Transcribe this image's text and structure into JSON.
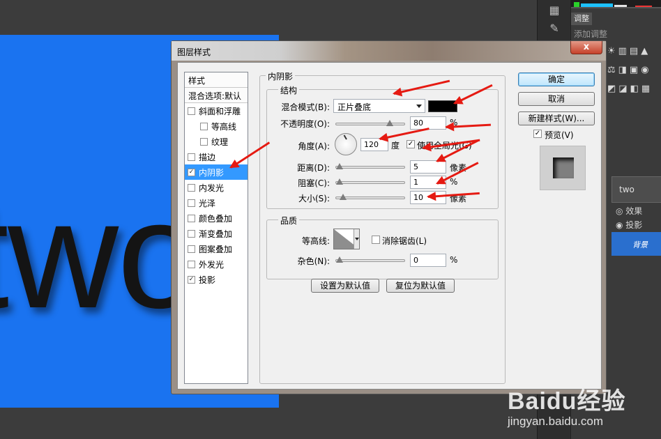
{
  "canvas": {
    "text": "two"
  },
  "side_panel": {
    "tab_label": "调整",
    "subtitle": "添加调整",
    "layer_name": "two",
    "effects_label": "效果",
    "effect_item": "投影",
    "background_layer": "背景"
  },
  "dialog": {
    "title": "图层样式",
    "close_label": "x",
    "style_list": {
      "header": "样式",
      "blend_options": "混合选项:默认",
      "items": [
        {
          "label": "斜面和浮雕",
          "checked": false
        },
        {
          "label": "等高线",
          "checked": false
        },
        {
          "label": "纹理",
          "checked": false
        },
        {
          "label": "描边",
          "checked": false
        },
        {
          "label": "内阴影",
          "checked": true
        },
        {
          "label": "内发光",
          "checked": false
        },
        {
          "label": "光泽",
          "checked": false
        },
        {
          "label": "颜色叠加",
          "checked": false
        },
        {
          "label": "渐变叠加",
          "checked": false
        },
        {
          "label": "图案叠加",
          "checked": false
        },
        {
          "label": "外发光",
          "checked": false
        },
        {
          "label": "投影",
          "checked": true
        }
      ]
    },
    "inner_shadow": {
      "title": "内阴影",
      "structure_title": "结构",
      "blend_mode_label": "混合模式(B):",
      "blend_mode_value": "正片叠底",
      "opacity_label": "不透明度(O):",
      "opacity_value": "80",
      "opacity_unit": "%",
      "opacity_fraction": 0.8,
      "angle_label": "角度(A):",
      "angle_value": "120",
      "angle_unit": "度",
      "global_light_label": "使用全局光(G)",
      "global_light_checked": true,
      "distance_label": "距离(D):",
      "distance_value": "5",
      "distance_unit": "像素",
      "choke_label": "阻塞(C):",
      "choke_value": "1",
      "choke_unit": "%",
      "size_label": "大小(S):",
      "size_value": "10",
      "size_unit": "像素",
      "quality_title": "品质",
      "contour_label": "等高线:",
      "antialias_label": "消除锯齿(L)",
      "noise_label": "杂色(N):",
      "noise_value": "0",
      "noise_unit": "%",
      "make_default": "设置为默认值",
      "reset_default": "复位为默认值"
    },
    "buttons": {
      "ok": "确定",
      "cancel": "取消",
      "new_style": "新建样式(W)...",
      "preview_label": "预览(V)",
      "preview_checked": true
    },
    "shadow_color": "#000000"
  },
  "watermark": {
    "logo": "Baidu经验",
    "url": "jingyan.baidu.com"
  },
  "colors": {
    "canvas_blue": "#1a73f0",
    "arrow_red": "#e51a12",
    "selection_blue": "#3399ff"
  }
}
